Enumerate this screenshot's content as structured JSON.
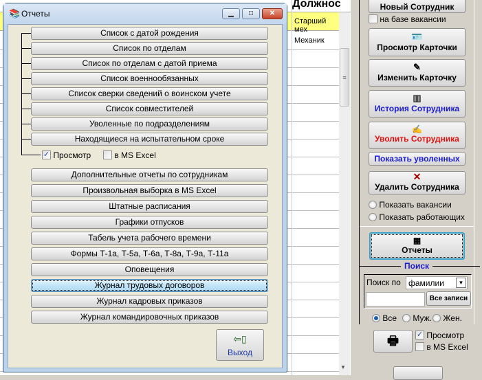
{
  "background_table": {
    "header_partial": "Должнос",
    "rows": [
      "Старший мех",
      "Механик"
    ]
  },
  "dialog": {
    "title": "Отчеты",
    "minimize": "▁",
    "maximize": "□",
    "close": "✕",
    "group1": [
      "Список с датой рождения",
      "Список по отделам",
      "Список по отделам с датой приема",
      "Список военнообязанных",
      "Список сверки сведений о воинском учете",
      "Список совместителей",
      "Уволенные по подразделениям",
      "Находящиеся на испытательном сроке"
    ],
    "preview_label": "Просмотр",
    "preview_checked": true,
    "excel_label": "в MS Excel",
    "excel_checked": false,
    "group2": [
      "Дополнительные отчеты по сотрудникам",
      "Произвольная выборка в MS Excel",
      "Штатные расписания",
      "Графики отпусков",
      "Табель учета рабочего времени",
      "Формы Т-1а, Т-5а, Т-6а, Т-8а, Т-9а, Т-11а",
      "Оповещения",
      "Журнал трудовых договоров",
      "Журнал кадровых приказов",
      "Журнал командировочных приказов"
    ],
    "selected": "Журнал трудовых договоров",
    "exit_label": "Выход"
  },
  "right_panel": {
    "new_employee": "Новый Сотрудник",
    "vacancy_based": "на базе вакансии",
    "view_card": "Просмотр Карточки",
    "edit_card": "Изменить Карточку",
    "history": "История Сотрудника",
    "dismiss": "Уволить Сотрудника",
    "show_dismissed": "Показать уволенных",
    "delete": "Удалить Сотрудника",
    "show_vacancies": "Показать вакансии",
    "show_working": "Показать работающих",
    "reports": "Отчеты",
    "search_title": "Поиск",
    "search_by_label": "Поиск по",
    "search_by_value": "фамилии",
    "search_input": "",
    "all_records": "Все записи",
    "gender": [
      "Все",
      "Муж.",
      "Жен."
    ],
    "gender_selected": "Все",
    "preview_label": "Просмотр",
    "preview_checked": true,
    "excel_label": "в MS Excel",
    "excel_checked": false
  },
  "colors": {
    "history": "#1a1ad0",
    "dismiss": "#e01010",
    "show_dismissed": "#1a1ad0",
    "search_title": "#1a1ad0",
    "exit": "#1a3aa8",
    "yellow_row": "#ffff80"
  }
}
